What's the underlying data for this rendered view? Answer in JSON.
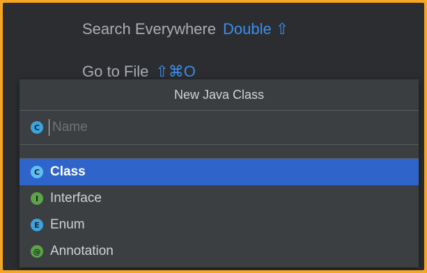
{
  "background_hints": [
    {
      "label": "Search Everywhere",
      "shortcut": "Double ⇧"
    },
    {
      "label": "Go to File",
      "shortcut": "⇧⌘O"
    }
  ],
  "dialog": {
    "title": "New Java Class",
    "name_input": {
      "value": "",
      "placeholder": "Name",
      "icon_letter": "C"
    },
    "kinds": [
      {
        "label": "Class",
        "icon_letter": "C",
        "icon": "class-icon",
        "selected": true
      },
      {
        "label": "Interface",
        "icon_letter": "I",
        "icon": "interface-icon",
        "selected": false
      },
      {
        "label": "Enum",
        "icon_letter": "E",
        "icon": "enum-icon",
        "selected": false
      },
      {
        "label": "Annotation",
        "icon_letter": "@",
        "icon": "annotation-icon",
        "selected": false
      }
    ]
  },
  "colors": {
    "accent": "#3b8ff0",
    "selection": "#2f65ca",
    "window_border": "#f5a623"
  }
}
